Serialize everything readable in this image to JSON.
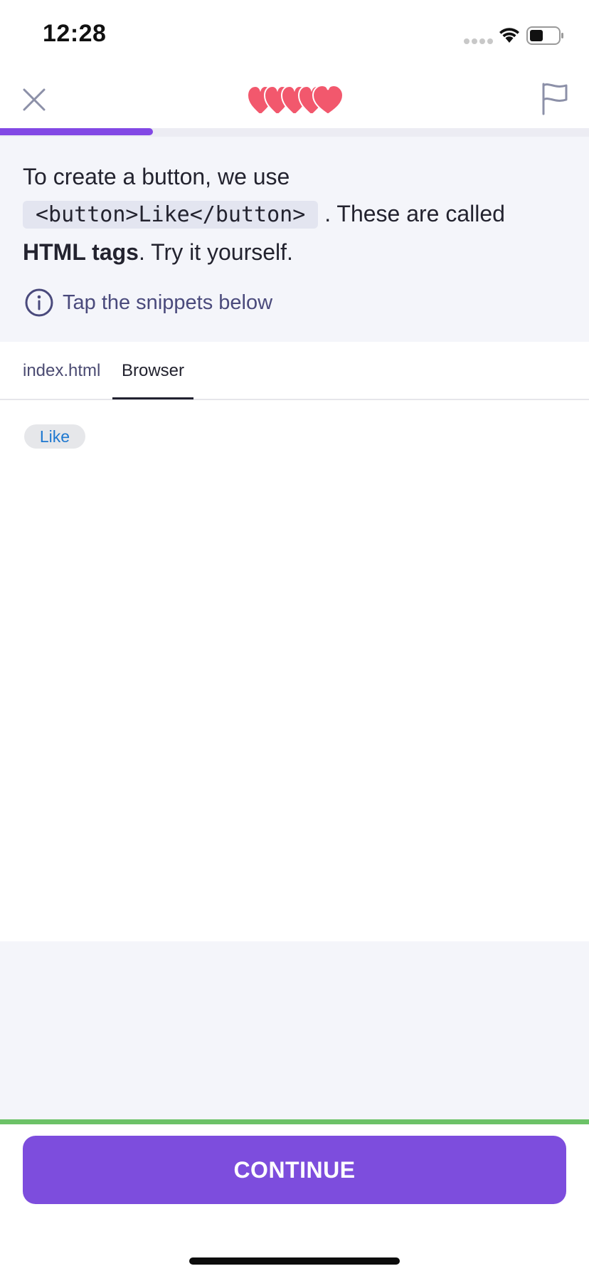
{
  "status_bar": {
    "time": "12:28"
  },
  "header": {
    "close_icon": "close-icon",
    "lives_icon": "hearts-icon",
    "lives_count": 5,
    "report_icon": "flag-icon",
    "progress": 0.26
  },
  "instruction": {
    "text_before": "To create a button, we use",
    "code": "<button>Like</button>",
    "text_after": " . These are called ",
    "bold_text": "HTML tags",
    "text_end": ".  Try it yourself.",
    "hint": "Tap the snippets below",
    "hint_icon": "info-icon"
  },
  "tabs": [
    {
      "label": "index.html",
      "active": false
    },
    {
      "label": "Browser",
      "active": true
    }
  ],
  "preview": {
    "button_label": "Like"
  },
  "footer": {
    "continue_label": "CONTINUE"
  },
  "colors": {
    "accent": "#8248e5",
    "button": "#7d4ddd",
    "hearts": "#f2586d",
    "success": "#6cc267",
    "link_blue": "#1e78d0"
  }
}
